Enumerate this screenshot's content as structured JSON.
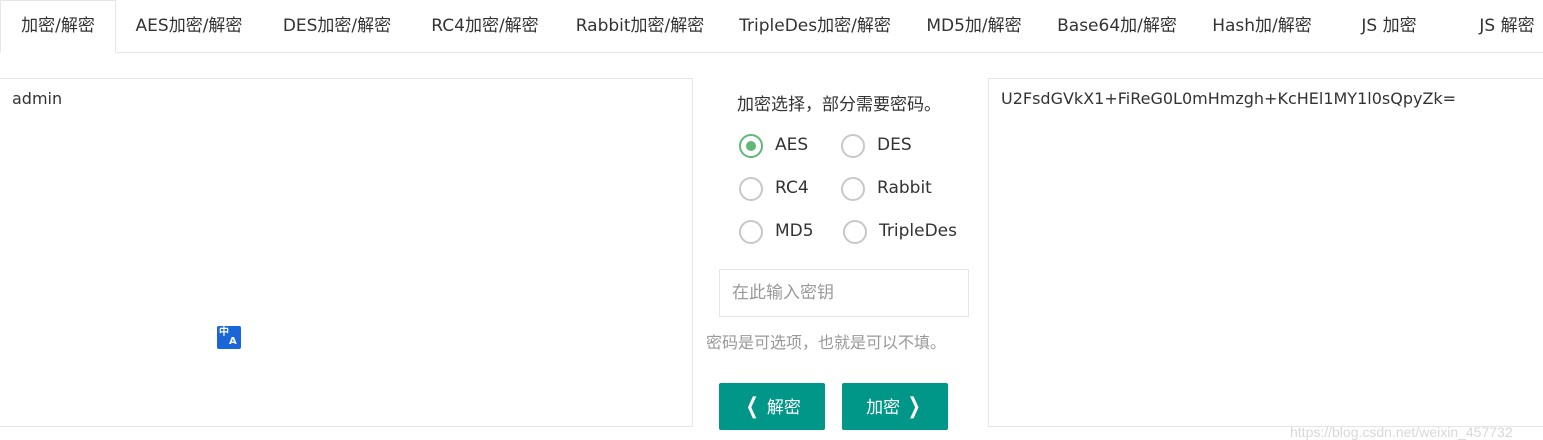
{
  "tabs": [
    {
      "label": "加密/解密"
    },
    {
      "label": "AES加密/解密"
    },
    {
      "label": "DES加密/解密"
    },
    {
      "label": "RC4加密/解密"
    },
    {
      "label": "Rabbit加密/解密"
    },
    {
      "label": "TripleDes加密/解密"
    },
    {
      "label": "MD5加/解密"
    },
    {
      "label": "Base64加/解密"
    },
    {
      "label": "Hash加/解密"
    },
    {
      "label": "JS 加密"
    },
    {
      "label": "JS 解密"
    }
  ],
  "active_tab_index": 0,
  "input": {
    "value": "admin"
  },
  "translate_icon": {
    "name": "translate-icon",
    "glyph_top": "中",
    "glyph_bottom": "A"
  },
  "options": {
    "hint": "加密选择，部分需要密码。",
    "radios": [
      {
        "label": "AES",
        "checked": true
      },
      {
        "label": "DES",
        "checked": false
      },
      {
        "label": "RC4",
        "checked": false
      },
      {
        "label": "Rabbit",
        "checked": false
      },
      {
        "label": "MD5",
        "checked": false
      },
      {
        "label": "TripleDes",
        "checked": false
      }
    ],
    "key_placeholder": "在此输入密钥",
    "key_value": "",
    "key_hint": "密码是可选项，也就是可以不填。"
  },
  "buttons": {
    "decrypt_label": "解密",
    "encrypt_label": "加密"
  },
  "output": {
    "value": "U2FsdGVkX1+FiReG0L0mHmzgh+KcHEl1MY1l0sQpyZk="
  },
  "watermark": "https://blog.csdn.net/weixin_457732",
  "colors": {
    "accent": "#009688",
    "radio_checked": "#5fb878",
    "translate_icon": "#1a66d9"
  }
}
